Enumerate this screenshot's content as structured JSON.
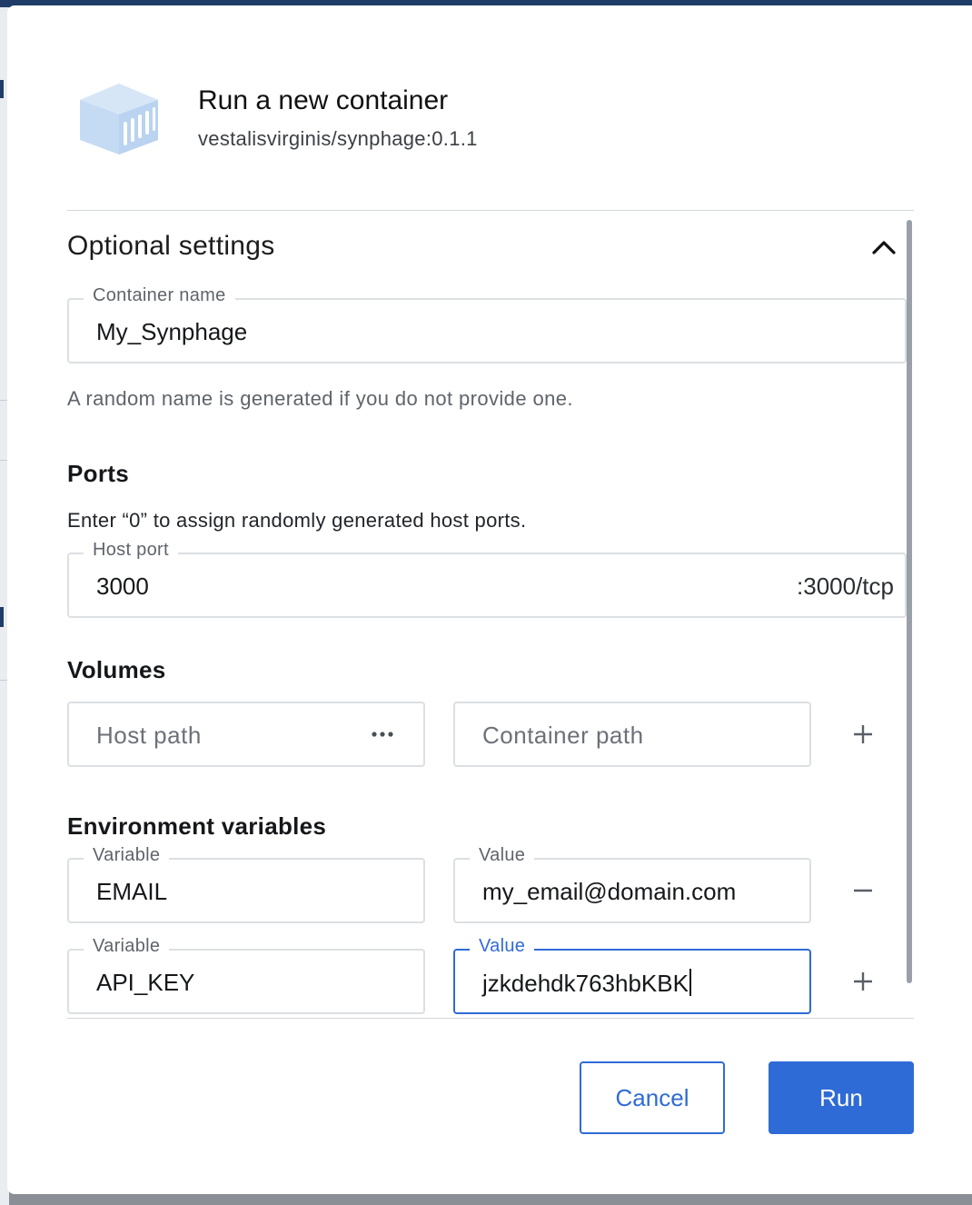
{
  "dialog": {
    "title": "Run a new container",
    "image_name": "vestalisvirginis/synphage:0.1.1",
    "logo_icon": "container-cube-icon"
  },
  "optional_settings": {
    "title": "Optional settings",
    "toggle_icon": "chevron-up-icon",
    "container_name": {
      "label": "Container name",
      "value": "My_Synphage",
      "helper": "A random name is generated if you do not provide one."
    }
  },
  "ports": {
    "title": "Ports",
    "description": "Enter “0” to assign randomly generated host ports.",
    "host_port": {
      "label": "Host port",
      "value": "3000",
      "suffix": ":3000/tcp"
    }
  },
  "volumes": {
    "title": "Volumes",
    "host_path_placeholder": "Host path",
    "container_path_placeholder": "Container path",
    "browse_icon": "more-horizontal-icon",
    "add_icon": "plus-icon"
  },
  "env": {
    "title": "Environment variables",
    "variable_label": "Variable",
    "value_label": "Value",
    "rows": [
      {
        "variable": "EMAIL",
        "value": "my_email@domain.com",
        "action_icon": "minus-icon"
      },
      {
        "variable": "API_KEY",
        "value": "jzkdehdk763hbKBK",
        "action_icon": "plus-icon"
      }
    ]
  },
  "actions": {
    "cancel": "Cancel",
    "run": "Run"
  },
  "colors": {
    "accent": "#2f6bd6",
    "logo": "#c5dbf3",
    "border": "#dcdfe3"
  }
}
